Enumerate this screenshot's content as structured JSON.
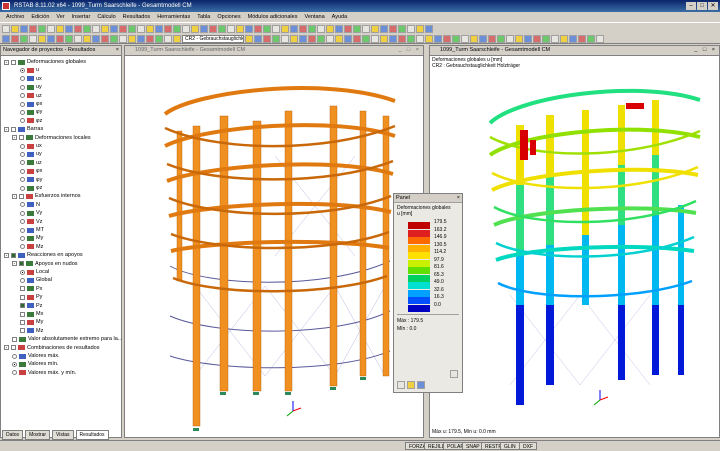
{
  "app": {
    "title": "RSTAB 8.11.02 x64 - 1099_Turm Saarschleife - Gesamtmodell CM",
    "win_min": "–",
    "win_max": "□",
    "win_close": "✕"
  },
  "menu": [
    "Archivo",
    "Edición",
    "Ver",
    "Insertar",
    "Cálculo",
    "Resultados",
    "Herramientas",
    "Tabla",
    "Opciones",
    "Módulos adicionales",
    "Ventana",
    "Ayuda"
  ],
  "toolbar": {
    "load_combo": "CR2 - Gebrauchstauglichkei"
  },
  "navigator": {
    "title": "Navegador de proyectos - Resultados",
    "close": "×",
    "items": [
      {
        "label": "Deformaciones globales",
        "indent": 0,
        "kind": "check",
        "expander": "-"
      },
      {
        "label": "u",
        "indent": 2,
        "kind": "radio",
        "on": true
      },
      {
        "label": "ux",
        "indent": 2,
        "kind": "radio"
      },
      {
        "label": "uy",
        "indent": 2,
        "kind": "radio"
      },
      {
        "label": "uz",
        "indent": 2,
        "kind": "radio"
      },
      {
        "label": "φx",
        "indent": 2,
        "kind": "radio"
      },
      {
        "label": "φy",
        "indent": 2,
        "kind": "radio"
      },
      {
        "label": "φz",
        "indent": 2,
        "kind": "radio"
      },
      {
        "label": "Barras",
        "indent": 0,
        "kind": "check",
        "expander": "-"
      },
      {
        "label": "Deformaciones locales",
        "indent": 1,
        "kind": "check",
        "expander": "-"
      },
      {
        "label": "ux",
        "indent": 2,
        "kind": "radio"
      },
      {
        "label": "uy",
        "indent": 2,
        "kind": "radio"
      },
      {
        "label": "uz",
        "indent": 2,
        "kind": "radio"
      },
      {
        "label": "φx",
        "indent": 2,
        "kind": "radio"
      },
      {
        "label": "φy",
        "indent": 2,
        "kind": "radio"
      },
      {
        "label": "φz",
        "indent": 2,
        "kind": "radio"
      },
      {
        "label": "Esfuerzos internos",
        "indent": 1,
        "kind": "check",
        "expander": "-"
      },
      {
        "label": "N",
        "indent": 2,
        "kind": "radio"
      },
      {
        "label": "Vy",
        "indent": 2,
        "kind": "radio"
      },
      {
        "label": "Vz",
        "indent": 2,
        "kind": "radio"
      },
      {
        "label": "MT",
        "indent": 2,
        "kind": "radio"
      },
      {
        "label": "My",
        "indent": 2,
        "kind": "radio"
      },
      {
        "label": "Mz",
        "indent": 2,
        "kind": "radio"
      },
      {
        "label": "Reacciones en apoyos",
        "indent": 0,
        "kind": "check",
        "checked": true,
        "expander": "-"
      },
      {
        "label": "Apoyos en nudos",
        "indent": 1,
        "kind": "check",
        "checked": true,
        "expander": "-"
      },
      {
        "label": "Local",
        "indent": 2,
        "kind": "radio",
        "on": true
      },
      {
        "label": "Global",
        "indent": 2,
        "kind": "radio"
      },
      {
        "label": "Px",
        "indent": 2,
        "kind": "check"
      },
      {
        "label": "Py",
        "indent": 2,
        "kind": "check"
      },
      {
        "label": "Pz",
        "indent": 2,
        "kind": "check",
        "checked": true
      },
      {
        "label": "Mx",
        "indent": 2,
        "kind": "check"
      },
      {
        "label": "My",
        "indent": 2,
        "kind": "check"
      },
      {
        "label": "Mz",
        "indent": 2,
        "kind": "check"
      },
      {
        "label": "Valor absolutamente extremo para la...",
        "indent": 1,
        "kind": "check"
      },
      {
        "label": "Combinaciones de resultados",
        "indent": 0,
        "kind": "check",
        "expander": "-"
      },
      {
        "label": "Valores máx.",
        "indent": 1,
        "kind": "radio"
      },
      {
        "label": "Valores mín.",
        "indent": 1,
        "kind": "radio",
        "on": true
      },
      {
        "label": "Valores máx. y mín.",
        "indent": 1,
        "kind": "radio"
      }
    ],
    "tabs": [
      {
        "label": "Datos"
      },
      {
        "label": "Mostrar"
      },
      {
        "label": "Vistas"
      },
      {
        "label": "Resultados",
        "active": true
      }
    ]
  },
  "views": {
    "left_title": "1099_Turm Saarschleife - Gesamtmodell CM",
    "right_title": "1099_Turm Saarschleife - Gesamtmodell CM",
    "right_line1": "Deformaciones globales u [mm]",
    "right_line2": "CR2 : Gebrauchstauglichkeit Holzträger",
    "right_footer": "Máx u: 179.5, Mín u: 0.0 mm",
    "buttons": "_ □ ×"
  },
  "panel": {
    "title": "Panel",
    "close": "×",
    "heading1": "Deformaciones globales",
    "heading2": "u [mm]",
    "legend": [
      {
        "value": "179.5",
        "color": "#c00000"
      },
      {
        "value": "163.2",
        "color": "#e02020"
      },
      {
        "value": "146.9",
        "color": "#ff6a00"
      },
      {
        "value": "130.5",
        "color": "#ffb000"
      },
      {
        "value": "114.2",
        "color": "#ffe000"
      },
      {
        "value": "97.9",
        "color": "#c8f000"
      },
      {
        "value": "81.6",
        "color": "#60e000"
      },
      {
        "value": "65.3",
        "color": "#00d060"
      },
      {
        "value": "49.0",
        "color": "#00e0d0"
      },
      {
        "value": "32.6",
        "color": "#00a0ff"
      },
      {
        "value": "16.3",
        "color": "#0050ff"
      },
      {
        "value": "0.0",
        "color": "#0000c0"
      }
    ],
    "max_label": "Máx :",
    "max_value": "179.5",
    "min_label": "Mín :",
    "min_value": "0.0"
  },
  "status_tabs": [
    "FORZADO",
    "REJILLA",
    "POLAR",
    "SNAP",
    "RESTRICT",
    "GLIN",
    "DXF"
  ]
}
